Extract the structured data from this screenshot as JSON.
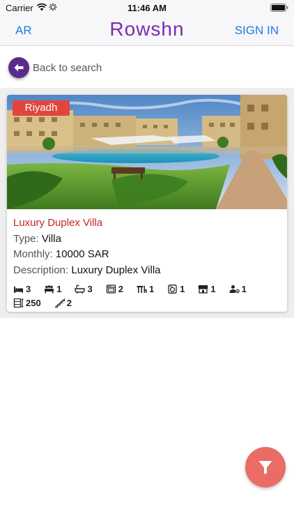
{
  "status_bar": {
    "carrier": "Carrier",
    "time": "11:46 AM"
  },
  "nav": {
    "language_toggle": "AR",
    "brand": "Rowshn",
    "sign_in": "SIGN IN"
  },
  "back": {
    "label": "Back to search"
  },
  "listing": {
    "city": "Riyadh",
    "title": "Luxury Duplex Villa",
    "type_label": "Type:",
    "type_value": "Villa",
    "monthly_label": "Monthly:",
    "monthly_value": "10000 SAR",
    "description_label": "Description:",
    "description_value": "Luxury Duplex Villa",
    "amenities_row1": [
      {
        "icon": "bed-icon",
        "value": "3"
      },
      {
        "icon": "living-room-icon",
        "value": "1"
      },
      {
        "icon": "bathtub-icon",
        "value": "3"
      },
      {
        "icon": "kitchen-icon",
        "value": "2"
      },
      {
        "icon": "dining-table-icon",
        "value": "1"
      },
      {
        "icon": "laundry-icon",
        "value": "1"
      },
      {
        "icon": "store-icon",
        "value": "1"
      },
      {
        "icon": "maid-room-icon",
        "value": "1"
      }
    ],
    "amenities_row2": [
      {
        "icon": "floors-icon",
        "value": "250"
      },
      {
        "icon": "stairs-icon",
        "value": "2"
      }
    ]
  },
  "colors": {
    "brand": "#7a2bb3",
    "link": "#1a7ee0",
    "badge": "#e0463d",
    "title": "#c0282a",
    "fab": "#ea6c66"
  }
}
